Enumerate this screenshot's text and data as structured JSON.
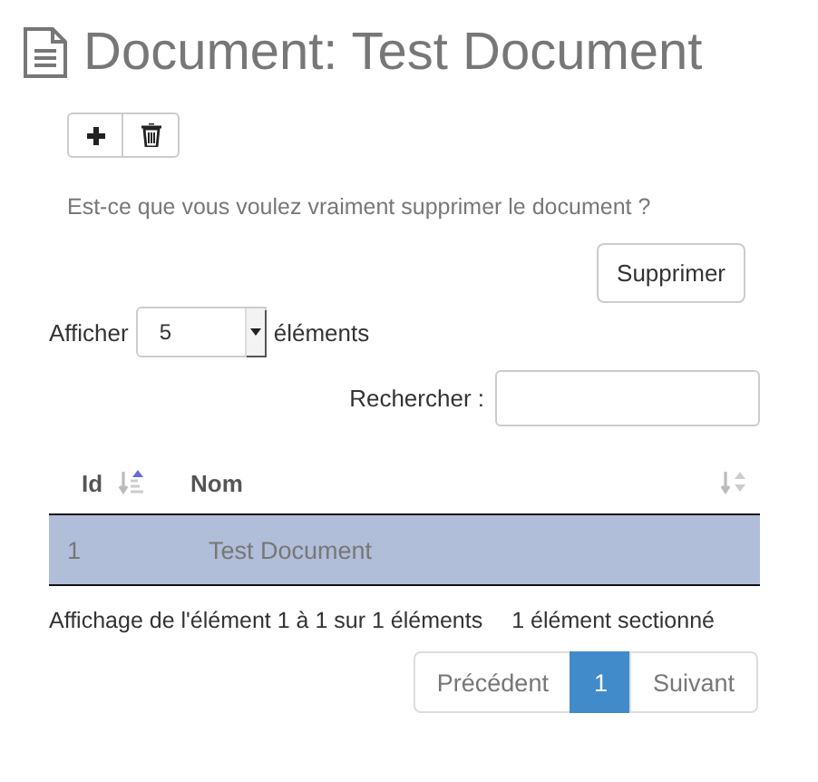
{
  "title": "Document: Test Document",
  "toolbar": [
    {
      "kind": "add"
    },
    {
      "kind": "delete"
    }
  ],
  "confirm": {
    "message": "Est-ce que vous voulez vraiment supprimer le document ?",
    "button": "Supprimer"
  },
  "length": {
    "label_before": "Afficher",
    "value": "5",
    "label_after": "éléments"
  },
  "search": {
    "label": "Rechercher :"
  },
  "table": {
    "columns": [
      {
        "label": "Id",
        "sorted": true
      },
      {
        "label": "Nom",
        "sorted": false
      }
    ],
    "rows": [
      {
        "cells": [
          "1",
          "Test Document"
        ],
        "selected": true
      }
    ]
  },
  "info": "Affichage de l'élément 1 à 1 sur 1 éléments",
  "select_info": "1 élément sectionné",
  "pagination": [
    {
      "label": "Précédent",
      "selected": false
    },
    {
      "label": "1",
      "selected": true
    },
    {
      "label": "Suivant",
      "selected": false
    }
  ]
}
